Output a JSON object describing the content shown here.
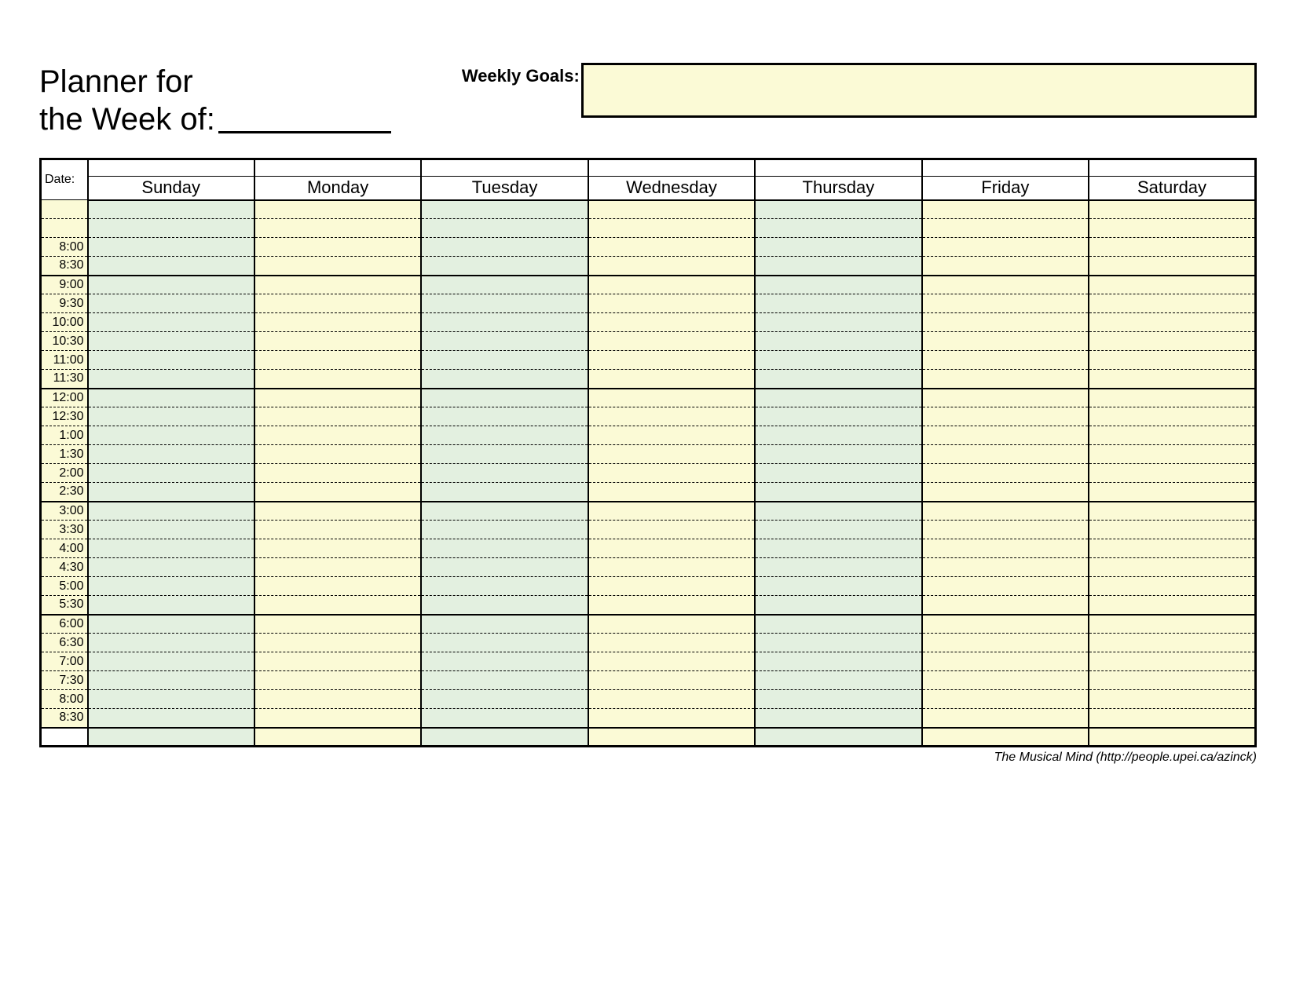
{
  "header": {
    "title_line1": "Planner for",
    "title_line2": "the Week of:",
    "goals_label": "Weekly Goals:"
  },
  "table": {
    "date_label": "Date:",
    "days": [
      "Sunday",
      "Monday",
      "Tuesday",
      "Wednesday",
      "Thursday",
      "Friday",
      "Saturday"
    ],
    "times": [
      "",
      "",
      "8:00",
      "8:30",
      "9:00",
      "9:30",
      "10:00",
      "10:30",
      "11:00",
      "11:30",
      "12:00",
      "12:30",
      "1:00",
      "1:30",
      "2:00",
      "2:30",
      "3:00",
      "3:30",
      "4:00",
      "4:30",
      "5:00",
      "5:30",
      "6:00",
      "6:30",
      "7:00",
      "7:30",
      "8:00",
      "8:30"
    ]
  },
  "footer": {
    "credit": "The Musical Mind  (http://people.upei.ca/azinck)"
  }
}
